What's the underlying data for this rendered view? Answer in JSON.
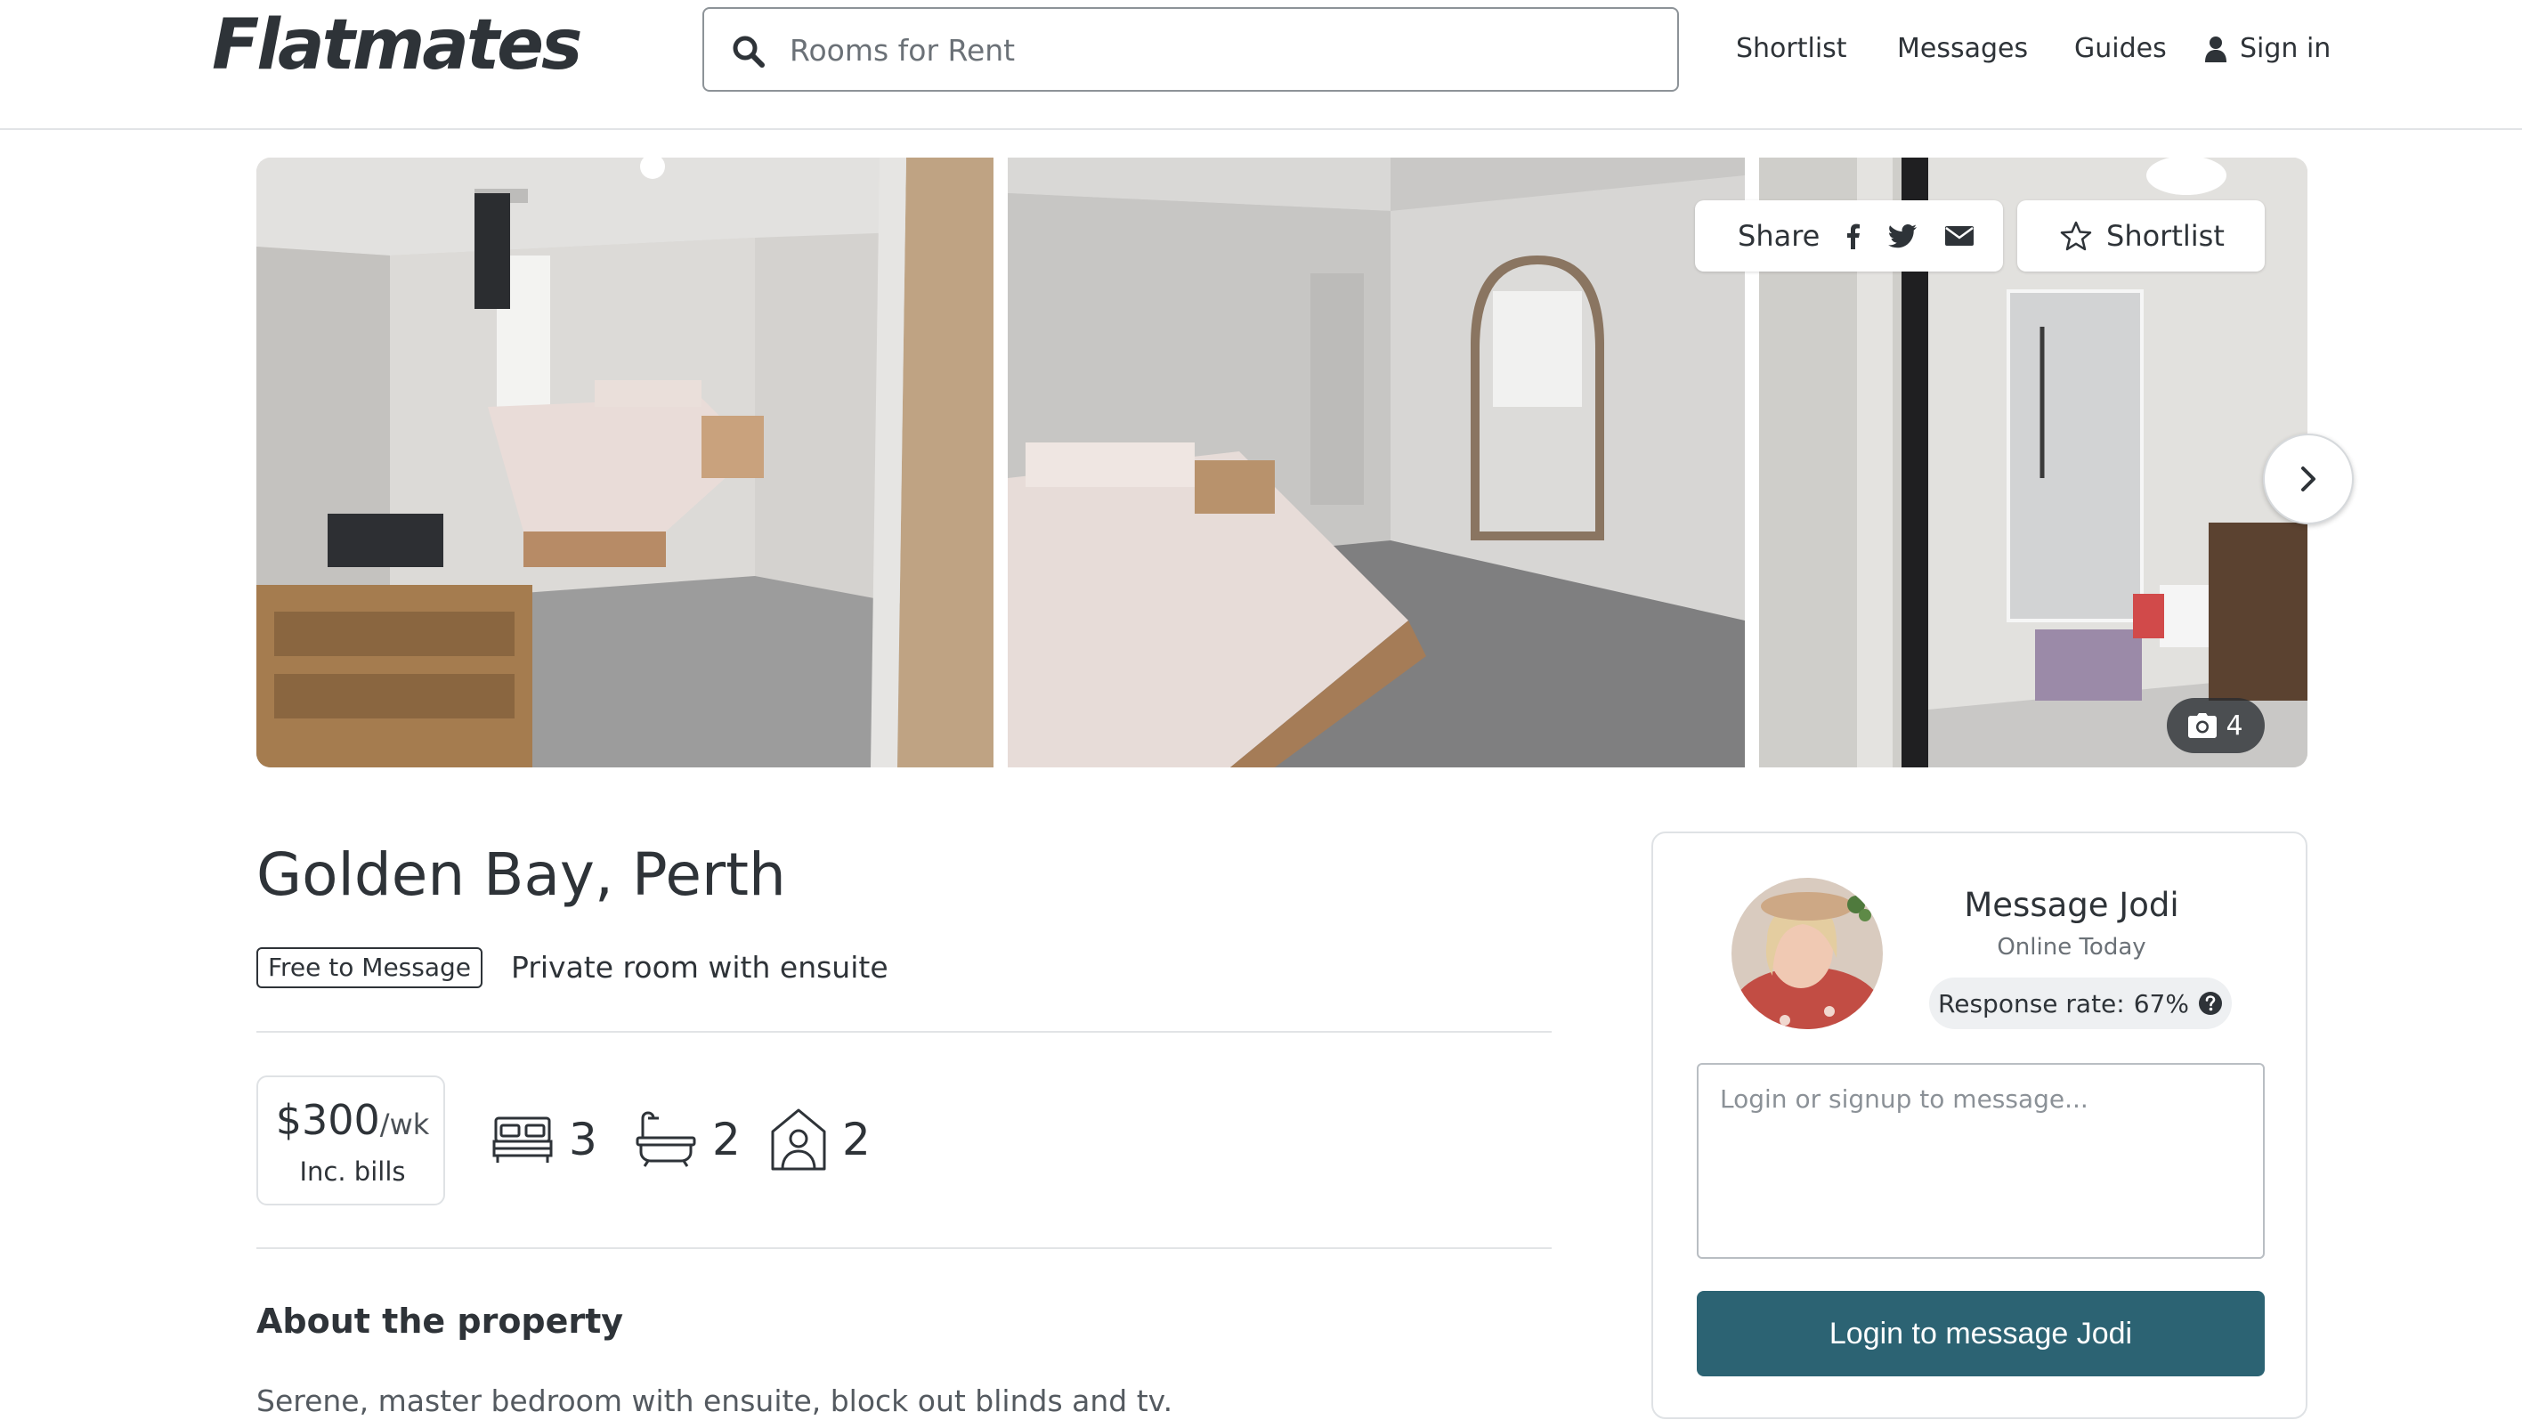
{
  "header": {
    "logo_text": "Flatmates",
    "search_placeholder": "Rooms for Rent",
    "nav": {
      "shortlist": "Shortlist",
      "messages": "Messages",
      "guides": "Guides",
      "sign_in": "Sign in"
    }
  },
  "gallery": {
    "share_label": "Share",
    "shortlist_label": "Shortlist",
    "photo_count": "4",
    "photos": [
      {
        "icon": "bedroom-photo"
      },
      {
        "icon": "bedroom-mirror-photo"
      },
      {
        "icon": "ensuite-photo"
      }
    ]
  },
  "listing": {
    "title": "Golden Bay, Perth",
    "badge": "Free to Message",
    "room_type": "Private room with ensuite",
    "price": "$300",
    "price_unit": "/wk",
    "price_note": "Inc. bills",
    "bedrooms": "3",
    "bathrooms": "2",
    "flatmates": "2",
    "about_heading": "About the property",
    "about_text": "Serene, master bedroom with ensuite, block out blinds and tv."
  },
  "message_card": {
    "title": "Message Jodi",
    "status": "Online Today",
    "response_label": "Response rate:",
    "response_value": "67%",
    "input_placeholder": "Login or signup to message...",
    "button_label": "Login to message Jodi"
  },
  "colors": {
    "primary_button": "#2c6373",
    "text": "#2e3338",
    "muted": "#6b7177",
    "border": "#dfe2e5"
  }
}
